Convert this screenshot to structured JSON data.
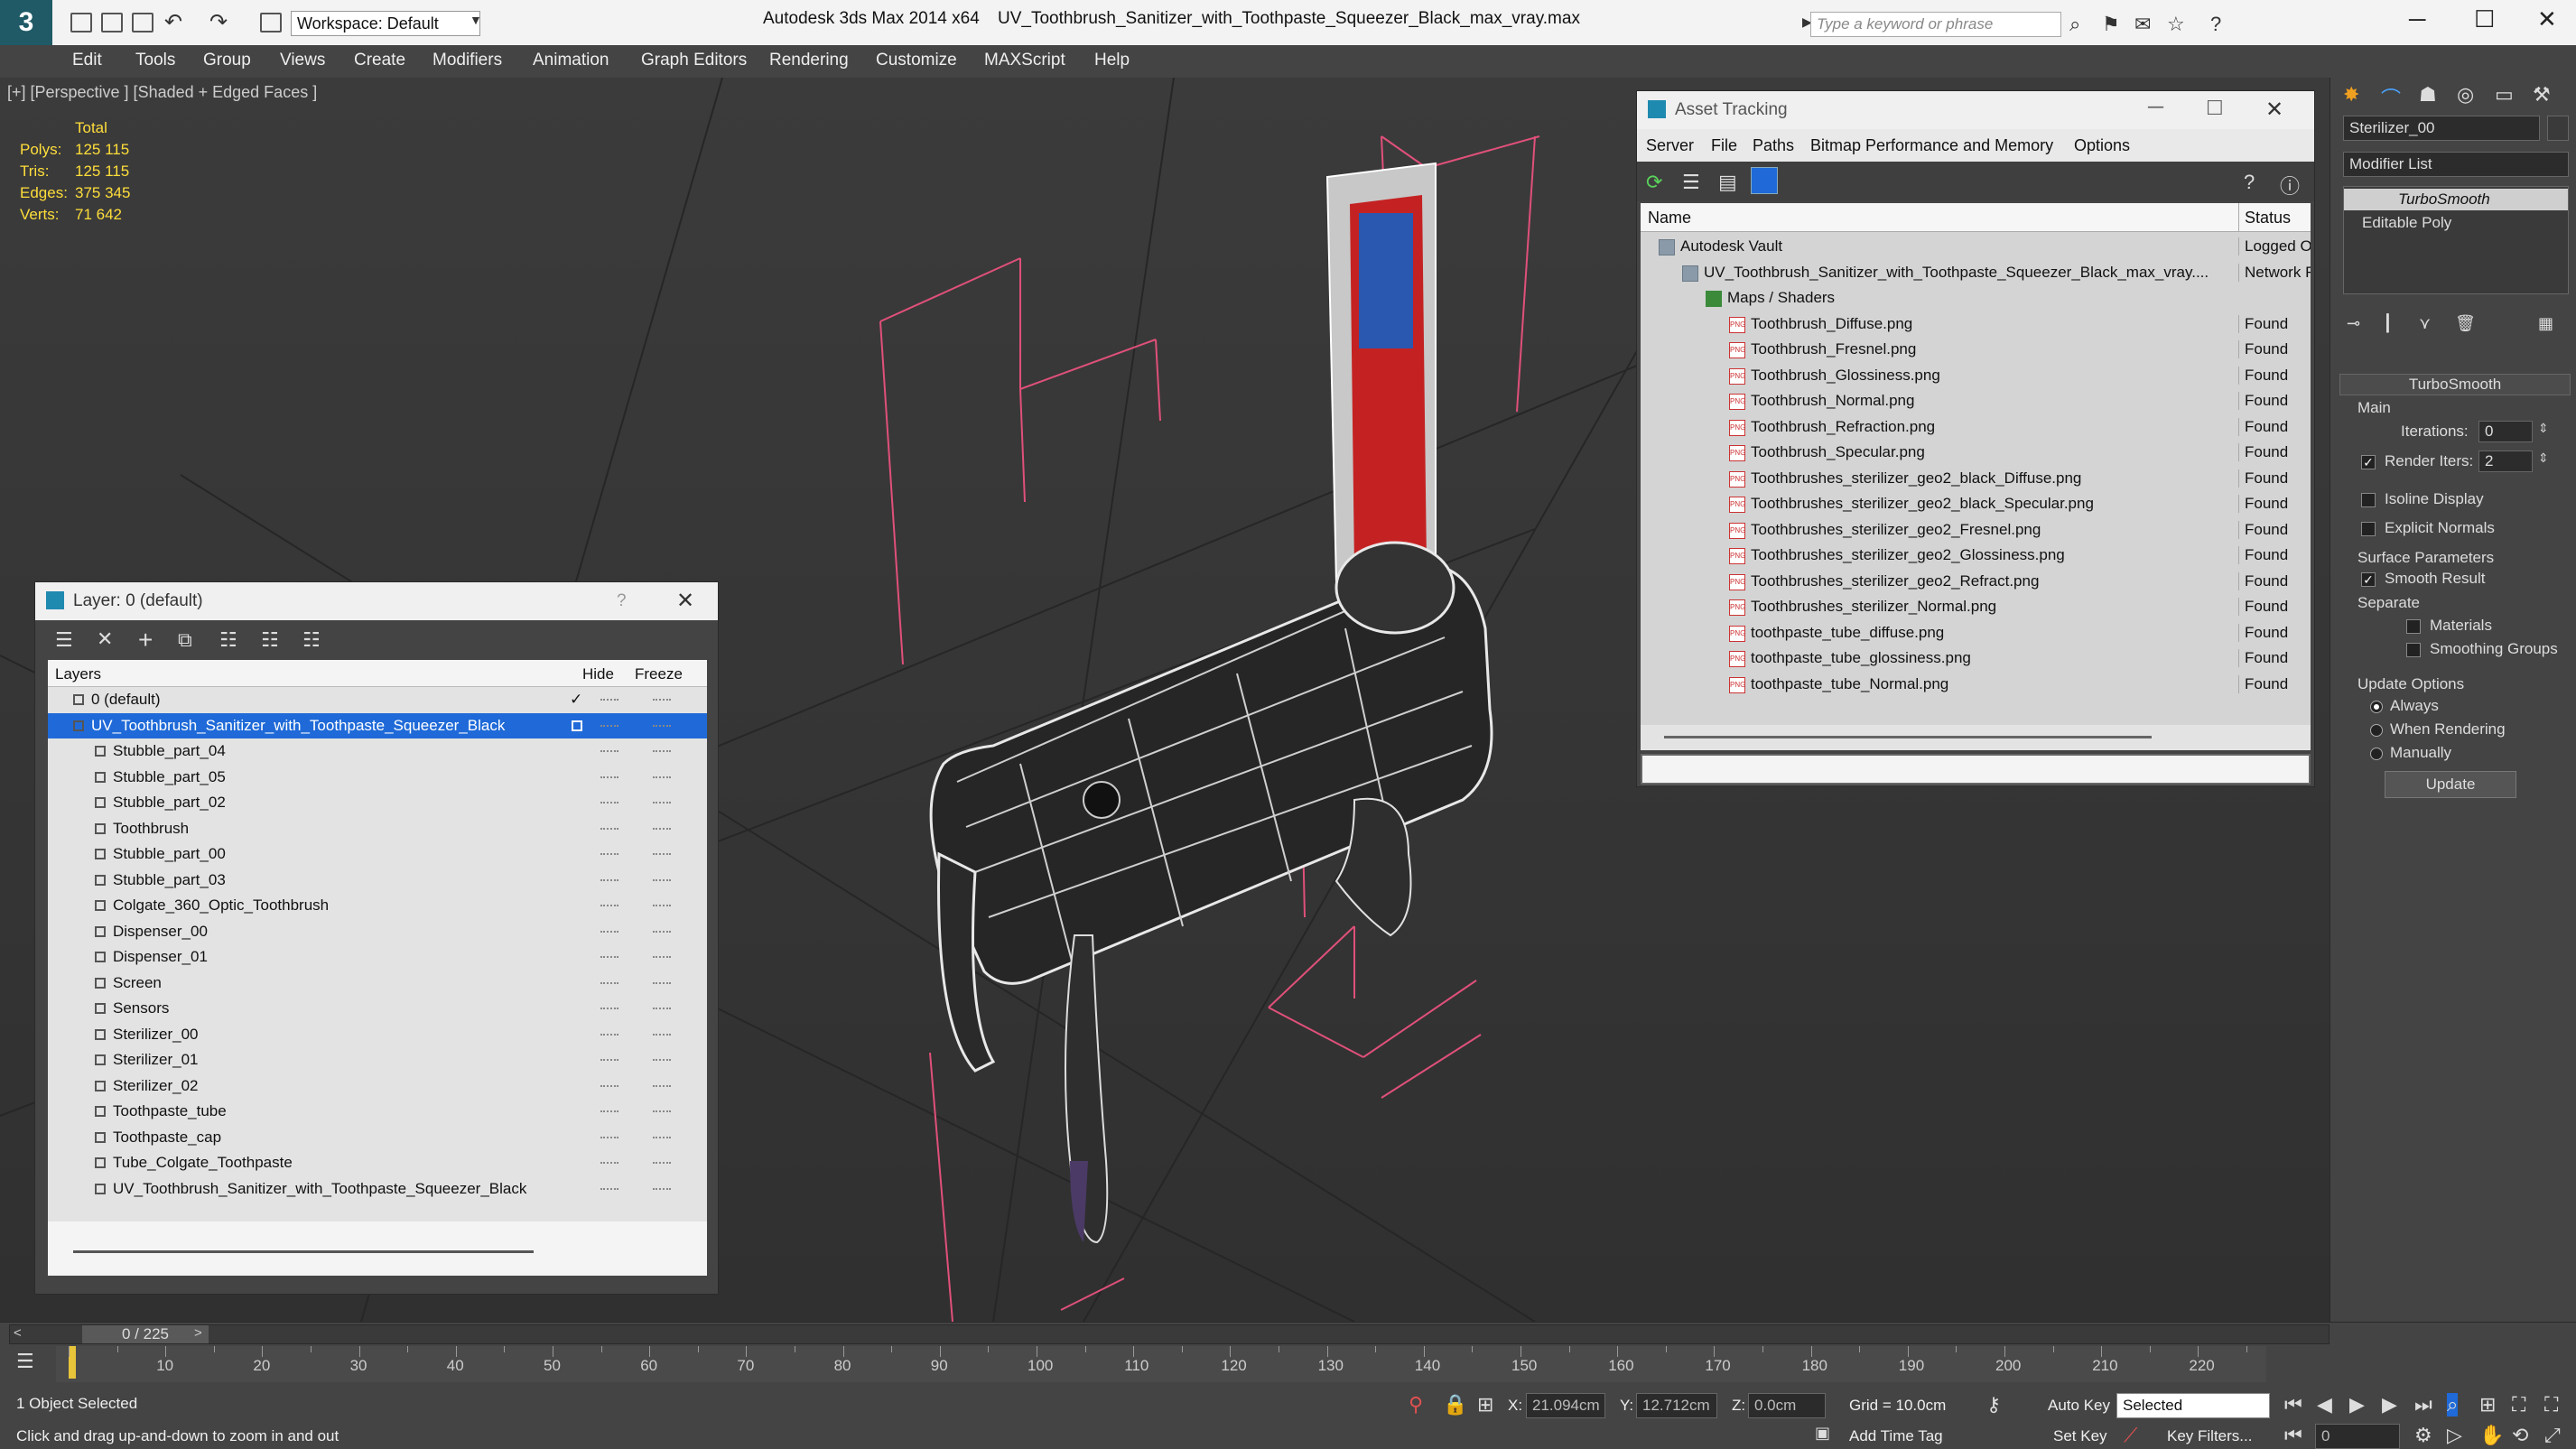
{
  "app": {
    "title": "Autodesk 3ds Max  2014 x64",
    "file": "UV_Toothbrush_Sanitizer_with_Toothpaste_Squeezer_Black_max_vray.max",
    "workspace": "Workspace: Default",
    "search_placeholder": "Type a keyword or phrase"
  },
  "menu": [
    "Edit",
    "Tools",
    "Group",
    "Views",
    "Create",
    "Modifiers",
    "Animation",
    "Graph Editors",
    "Rendering",
    "Customize",
    "MAXScript",
    "Help"
  ],
  "viewport": {
    "label": "[+] [Perspective ] [Shaded + Edged Faces ]",
    "stats": {
      "total_label": "Total",
      "rows": [
        {
          "label": "Polys:",
          "value": "125 115"
        },
        {
          "label": "Tris:",
          "value": "125 115"
        },
        {
          "label": "Edges:",
          "value": "375 345"
        },
        {
          "label": "Verts:",
          "value": "71 642"
        }
      ]
    }
  },
  "layer_dialog": {
    "title": "Layer: 0 (default)",
    "help": "?",
    "columns": {
      "layers": "Layers",
      "hide": "Hide",
      "freeze": "Freeze"
    },
    "rows": [
      {
        "name": "0 (default)",
        "level": 0,
        "checked": true
      },
      {
        "name": "UV_Toothbrush_Sanitizer_with_Toothpaste_Squeezer_Black",
        "level": 0,
        "selected": true
      },
      {
        "name": "Stubble_part_04",
        "level": 1
      },
      {
        "name": "Stubble_part_05",
        "level": 1
      },
      {
        "name": "Stubble_part_02",
        "level": 1
      },
      {
        "name": "Toothbrush",
        "level": 1
      },
      {
        "name": "Stubble_part_00",
        "level": 1
      },
      {
        "name": "Stubble_part_03",
        "level": 1
      },
      {
        "name": "Colgate_360_Optic_Toothbrush",
        "level": 1
      },
      {
        "name": "Dispenser_00",
        "level": 1
      },
      {
        "name": "Dispenser_01",
        "level": 1
      },
      {
        "name": "Screen",
        "level": 1
      },
      {
        "name": "Sensors",
        "level": 1
      },
      {
        "name": "Sterilizer_00",
        "level": 1
      },
      {
        "name": "Sterilizer_01",
        "level": 1
      },
      {
        "name": "Sterilizer_02",
        "level": 1
      },
      {
        "name": "Toothpaste_tube",
        "level": 1
      },
      {
        "name": "Toothpaste_cap",
        "level": 1
      },
      {
        "name": "Tube_Colgate_Toothpaste",
        "level": 1
      },
      {
        "name": "UV_Toothbrush_Sanitizer_with_Toothpaste_Squeezer_Black",
        "level": 1
      }
    ]
  },
  "asset_tracking": {
    "title": "Asset Tracking",
    "menu": [
      "Server",
      "File",
      "Paths",
      "Bitmap Performance and Memory",
      "Options"
    ],
    "columns": {
      "name": "Name",
      "status": "Status"
    },
    "rows": [
      {
        "name": "Autodesk Vault",
        "status": "Logged O",
        "level": 1,
        "icon": "vault-icon"
      },
      {
        "name": "UV_Toothbrush_Sanitizer_with_Toothpaste_Squeezer_Black_max_vray....",
        "status": "Network F",
        "level": 2,
        "icon": "max-file-icon"
      },
      {
        "name": "Maps / Shaders",
        "status": "",
        "level": 3,
        "icon": "maps-folder-icon"
      },
      {
        "name": "Toothbrush_Diffuse.png",
        "status": "Found",
        "level": 4,
        "icon": "png-file-icon"
      },
      {
        "name": "Toothbrush_Fresnel.png",
        "status": "Found",
        "level": 4,
        "icon": "png-file-icon"
      },
      {
        "name": "Toothbrush_Glossiness.png",
        "status": "Found",
        "level": 4,
        "icon": "png-file-icon"
      },
      {
        "name": "Toothbrush_Normal.png",
        "status": "Found",
        "level": 4,
        "icon": "png-file-icon"
      },
      {
        "name": "Toothbrush_Refraction.png",
        "status": "Found",
        "level": 4,
        "icon": "png-file-icon"
      },
      {
        "name": "Toothbrush_Specular.png",
        "status": "Found",
        "level": 4,
        "icon": "png-file-icon"
      },
      {
        "name": "Toothbrushes_sterilizer_geo2_black_Diffuse.png",
        "status": "Found",
        "level": 4,
        "icon": "png-file-icon"
      },
      {
        "name": "Toothbrushes_sterilizer_geo2_black_Specular.png",
        "status": "Found",
        "level": 4,
        "icon": "png-file-icon"
      },
      {
        "name": "Toothbrushes_sterilizer_geo2_Fresnel.png",
        "status": "Found",
        "level": 4,
        "icon": "png-file-icon"
      },
      {
        "name": "Toothbrushes_sterilizer_geo2_Glossiness.png",
        "status": "Found",
        "level": 4,
        "icon": "png-file-icon"
      },
      {
        "name": "Toothbrushes_sterilizer_geo2_Refract.png",
        "status": "Found",
        "level": 4,
        "icon": "png-file-icon"
      },
      {
        "name": "Toothbrushes_sterilizer_Normal.png",
        "status": "Found",
        "level": 4,
        "icon": "png-file-icon"
      },
      {
        "name": "toothpaste_tube_diffuse.png",
        "status": "Found",
        "level": 4,
        "icon": "png-file-icon"
      },
      {
        "name": "toothpaste_tube_glossiness.png",
        "status": "Found",
        "level": 4,
        "icon": "png-file-icon"
      },
      {
        "name": "toothpaste_tube_Normal.png",
        "status": "Found",
        "level": 4,
        "icon": "png-file-icon"
      }
    ]
  },
  "command_panel": {
    "object_name": "Sterilizer_00",
    "modifier_list": "Modifier List",
    "stack": [
      {
        "name": "TurboSmooth",
        "active": true
      },
      {
        "name": "Editable Poly",
        "active": false
      }
    ],
    "rollout_title": "TurboSmooth",
    "main_label": "Main",
    "iterations_label": "Iterations:",
    "iterations_value": "0",
    "render_iters_label": "Render Iters:",
    "render_iters_value": "2",
    "render_iters_checked": true,
    "isoline_label": "Isoline Display",
    "explicit_normals_label": "Explicit Normals",
    "surface_params_label": "Surface Parameters",
    "smooth_result_label": "Smooth Result",
    "smooth_result_checked": true,
    "separate_label": "Separate",
    "materials_label": "Materials",
    "smoothing_groups_label": "Smoothing Groups",
    "update_options_label": "Update Options",
    "radio_always": "Always",
    "radio_when_rendering": "When Rendering",
    "radio_manually": "Manually",
    "update_button": "Update"
  },
  "timeline": {
    "frame_display": "0 / 225",
    "ticks": [
      "10",
      "20",
      "30",
      "40",
      "50",
      "60",
      "70",
      "80",
      "90",
      "100",
      "110",
      "120",
      "130",
      "140",
      "150",
      "160",
      "170",
      "180",
      "190",
      "200",
      "210",
      "220"
    ]
  },
  "status": {
    "selection": "1 Object Selected",
    "prompt": "Click and drag up-and-down to zoom in and out",
    "x_label": "X:",
    "x_value": "21.094cm",
    "y_label": "Y:",
    "y_value": "12.712cm",
    "z_label": "Z:",
    "z_value": "0.0cm",
    "grid": "Grid = 10.0cm",
    "auto_key": "Auto Key",
    "selected": "Selected",
    "set_key": "Set Key",
    "key_filters": "Key Filters...",
    "add_time_tag": "Add Time Tag",
    "frame_field": "0"
  },
  "colors": {
    "selection_blue": "#1f6ad8",
    "viewport_bg": "#363636",
    "stat_yellow": "#ffde3a",
    "helper_pink": "#e0507a"
  }
}
